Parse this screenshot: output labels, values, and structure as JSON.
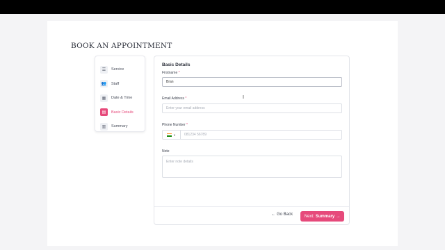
{
  "page": {
    "title": "BOOK AN APPOINTMENT"
  },
  "steps": [
    {
      "label": "Service",
      "icon": "list-icon"
    },
    {
      "label": "Staff",
      "icon": "users-icon"
    },
    {
      "label": "Date & Time",
      "icon": "calendar-icon"
    },
    {
      "label": "Basic Details",
      "icon": "id-card-icon",
      "active": true
    },
    {
      "label": "Summary",
      "icon": "summary-icon"
    }
  ],
  "form": {
    "title": "Basic Details",
    "firstname": {
      "label": "Firstname",
      "value": "Bran"
    },
    "email": {
      "label": "Email Address",
      "placeholder": "Enter your email address"
    },
    "phone": {
      "label": "Phone Number",
      "placeholder": "081234 56789"
    },
    "note": {
      "label": "Note",
      "placeholder": "Enter note details"
    },
    "required_mark": "*"
  },
  "actions": {
    "back": "Go Back",
    "next_prefix": "Next:",
    "next_target": "Summary"
  },
  "colors": {
    "accent": "#e64a7b"
  }
}
